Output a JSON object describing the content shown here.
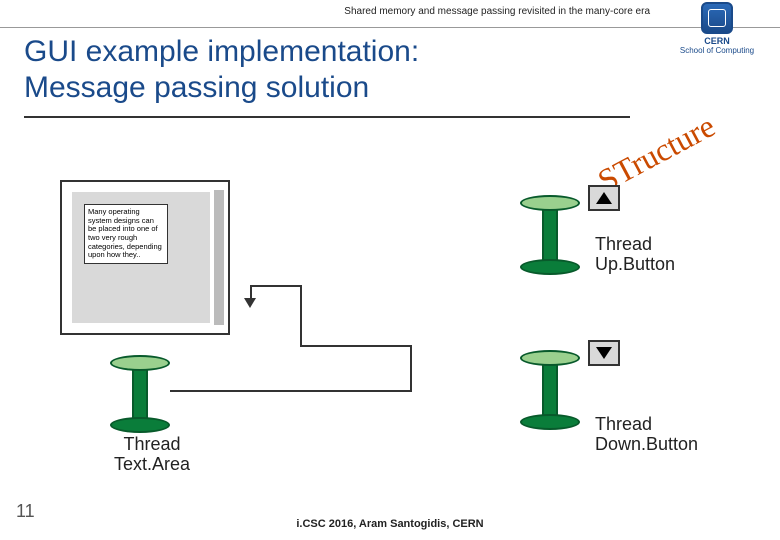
{
  "header": {
    "topic": "Shared memory and message passing revisited in the many-core era",
    "org_name": "CERN",
    "org_sub": "School of Computing"
  },
  "title": {
    "line1": "GUI example implementation:",
    "line2": "Message passing solution"
  },
  "diagram": {
    "structure_label": "STructure",
    "textarea_sample_text": "Many operating system designs can be placed into one of two very rough categories, depending upon how they..",
    "threads": {
      "textarea": {
        "label_line1": "Thread",
        "label_line2": "Text.Area"
      },
      "up": {
        "label_line1": "Thread",
        "label_line2": "Up.Button"
      },
      "down": {
        "label_line1": "Thread",
        "label_line2": "Down.Button"
      }
    }
  },
  "footer": {
    "page": "11",
    "credit": "i.CSC 2016, Aram Santogidis, CERN"
  }
}
